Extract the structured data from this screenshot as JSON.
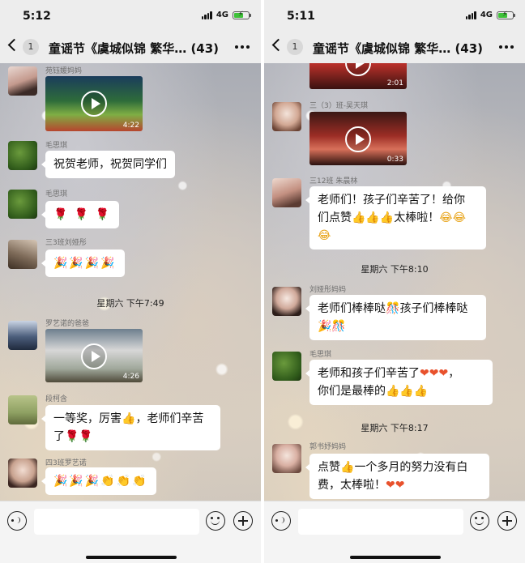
{
  "left": {
    "status": {
      "time": "5:12",
      "network": "4G"
    },
    "nav": {
      "badge": "1",
      "title": "童谣节《虞城似锦 繁华… (43)"
    },
    "messages": [
      {
        "sender": "苑钰媛妈妈",
        "duration": "4:22"
      },
      {
        "sender": "毛思琪",
        "text": "祝贺老师，祝贺同学们"
      },
      {
        "sender": "毛思琪",
        "emoji": "🌹 🌹 🌹"
      },
      {
        "sender": "三3班刘娅彤",
        "emoji": "🎉🎉🎉🎉"
      },
      {
        "divider": "星期六 下午7:49"
      },
      {
        "sender": "罗艺诺的爸爸",
        "duration": "4:26"
      },
      {
        "sender": "段柯含",
        "text_line1": "一等奖，厉害",
        "text_line2": "，老师们辛苦",
        "text_line3": "了"
      },
      {
        "sender": "四3班罗艺诺",
        "emoji": "🎉🎉🎉👏👏👏"
      }
    ]
  },
  "right": {
    "status": {
      "time": "5:11",
      "network": "4G"
    },
    "nav": {
      "badge": "1",
      "title": "童谣节《虞城似锦 繁华… (43)"
    },
    "messages": [
      {
        "duration": "2:01"
      },
      {
        "sender": "三（3）班-吴天琪",
        "duration": "0:33"
      },
      {
        "sender": "三12班 朱晨林",
        "text_line1": "老师们！孩子们辛苦了！给你",
        "text_line2": "们点赞",
        "text_line3": "太棒啦！"
      },
      {
        "divider": "星期六 下午8:10"
      },
      {
        "sender": "刘娅彤妈妈",
        "text_line1": "老师们棒棒哒",
        "text_line2": "孩子们棒棒哒"
      },
      {
        "sender": "毛思琪",
        "text_line1": "老师和孩子们辛苦了",
        "text_line2": "你们是最棒的"
      },
      {
        "divider": "星期六 下午8:17"
      },
      {
        "sender": "郭书妤妈妈",
        "text_line1": "点赞",
        "text_line2": "一个多月的努力没有白",
        "text_line3": "费，太棒啦！"
      }
    ]
  },
  "colors": {
    "bubble": "#ffffff",
    "bar": "#ededed",
    "accent_green": "#3fc23a"
  }
}
